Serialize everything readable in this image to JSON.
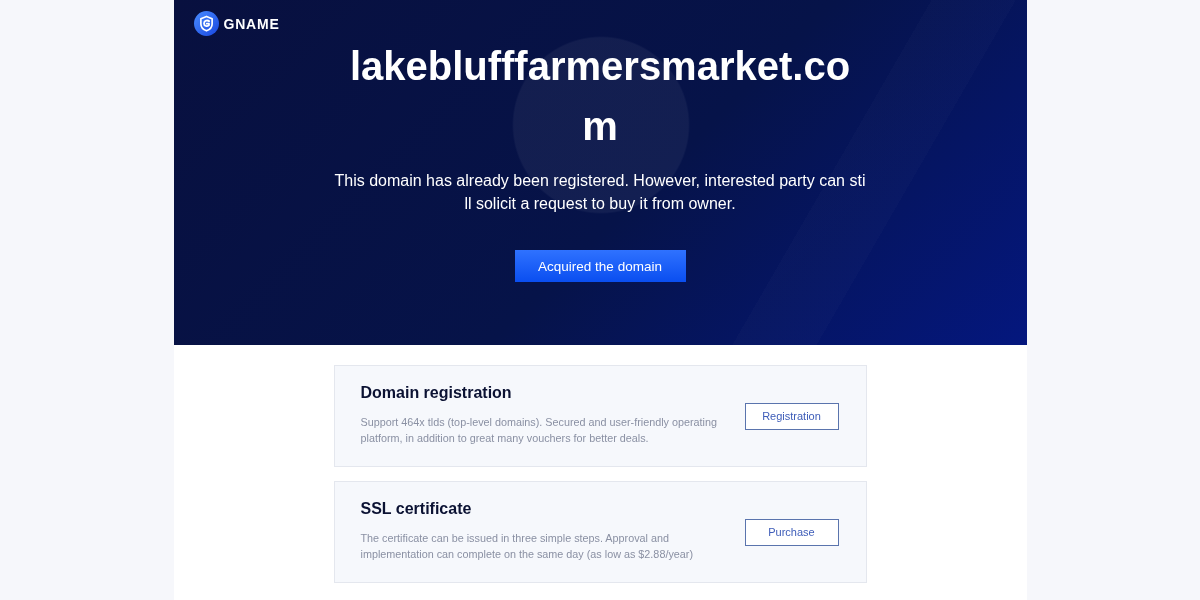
{
  "header": {
    "brand": "GNAME"
  },
  "hero": {
    "domain": "lakeblufffarmersmarket.com",
    "message": "This domain has already been registered. However, interested party can still solicit a request to buy it from owner.",
    "button": "Acquired the domain"
  },
  "services": [
    {
      "title": "Domain registration",
      "description": "Support 464x tlds (top-level domains). Secured and user-friendly operating platform, in addition to great many vouchers for better deals.",
      "button": "Registration"
    },
    {
      "title": "SSL certificate",
      "description": "The certificate can be issued in three simple steps. Approval and implementation can complete on the same day (as low as $2.88/year)",
      "button": "Purchase"
    }
  ]
}
